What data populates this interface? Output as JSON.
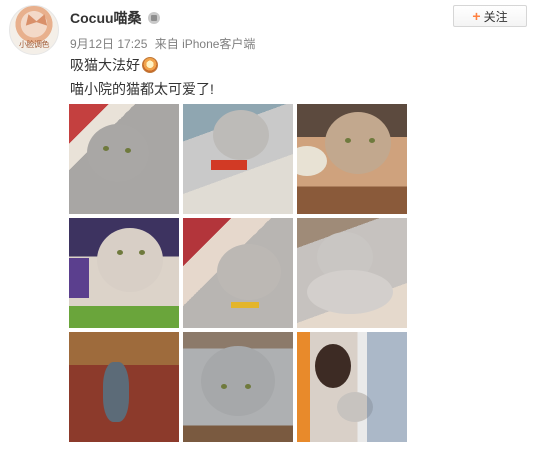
{
  "post": {
    "username": "Cocuu喵桑",
    "date": "9月12日 17:25",
    "source": "来自 iPhone客户端",
    "follow_label": "关注",
    "line1": "吸猫大法好",
    "line2": "喵小院的猫都太可爱了!",
    "avatar_caption": "小脸调色",
    "icons": {
      "vip": "vip-badge-icon",
      "emoji": "cat-emoji-icon",
      "follow": "plus-icon"
    },
    "colors": {
      "follow_plus": "#ff8140",
      "meta_text": "#808080",
      "body_text": "#333333"
    }
  },
  "photos": [
    {
      "subject": "grey-cat-on-plaid-blanket"
    },
    {
      "subject": "cat-playing-with-red-toy"
    },
    {
      "subject": "cat-eating-from-bowl"
    },
    {
      "subject": "cat-with-purple-feather-toy"
    },
    {
      "subject": "sleeping-cat-on-blanket"
    },
    {
      "subject": "cat-lying-on-side"
    },
    {
      "subject": "cat-on-red-floor"
    },
    {
      "subject": "grey-cat-close-up"
    },
    {
      "subject": "person-holding-cat"
    }
  ]
}
